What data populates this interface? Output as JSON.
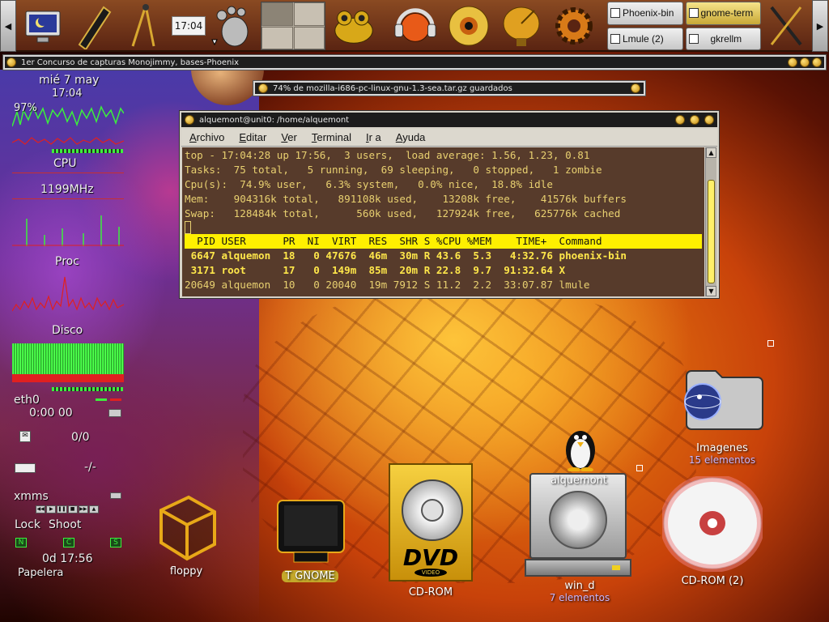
{
  "panel": {
    "clock": "17:04",
    "left_arrow": "◀",
    "right_arrow": "▶",
    "launchers": [
      "display-settings-icon",
      "pen-icon",
      "compass-icon",
      "gnome-foot-icon",
      "frog-icon",
      "headphones-icon",
      "eye-icon",
      "satellite-dish-icon",
      "gear-icon",
      "pen-tool-icon"
    ],
    "tasks": [
      {
        "label": "Phoenix-bin",
        "active": false
      },
      {
        "label": "gnome-term",
        "active": true
      },
      {
        "label": "Lmule (2)",
        "active": false
      },
      {
        "label": "gkrellm",
        "active": false
      }
    ]
  },
  "xmms_bar": {
    "title": "1er Concurso de capturas Monojimmy, bases-Phoenix"
  },
  "download_bar": {
    "title": "74% de mozilla-i686-pc-linux-gnu-1.3-sea.tar.gz guardados"
  },
  "gkrellm": {
    "date": "mié  7 may",
    "time": "17:04",
    "cpu_percent": "97%",
    "cpu_label": "CPU",
    "freq": "1199MHz",
    "proc_label": "Proc",
    "disk_label": "Disco",
    "net_label": "eth0",
    "net_time": "0:00 00",
    "mail_count": "0/0",
    "mail2": "-/-",
    "xmms_label": "xmms",
    "lock_label": "Lock",
    "shoot_label": "Shoot",
    "uptime": "0d 17:56",
    "trash_label": "Papelera",
    "keys": [
      "N",
      "C",
      "S"
    ]
  },
  "terminal": {
    "title": "alquemont@unit0: /home/alquemont",
    "menu": [
      "Archivo",
      "Editar",
      "Ver",
      "Terminal",
      "Ir a",
      "Ayuda"
    ],
    "lines": [
      "top - 17:04:28 up 17:56,  3 users,  load average: 1.56, 1.23, 0.81",
      "Tasks:  75 total,   5 running,  69 sleeping,   0 stopped,   1 zombie",
      "Cpu(s):  74.9% user,   6.3% system,   0.0% nice,  18.8% idle",
      "Mem:    904316k total,   891108k used,    13208k free,    41576k buffers",
      "Swap:   128484k total,      560k used,   127924k free,   625776k cached"
    ],
    "header": "  PID USER      PR  NI  VIRT  RES  SHR S %CPU %MEM    TIME+  Command",
    "procs": [
      " 6647 alquemon  18   0 47676  46m  30m R 43.6  5.3   4:32.76 phoenix-bin",
      " 3171 root      17   0  149m  85m  20m R 22.8  9.7  91:32.64 X",
      "20649 alquemon  10   0 20040  19m 7912 S 11.2  2.2  33:07.87 lmule"
    ]
  },
  "desktop": {
    "icons": [
      {
        "name": "floppy",
        "label": "floppy",
        "sub": ""
      },
      {
        "name": "t-gnome",
        "label": "T GNOME",
        "sub": ""
      },
      {
        "name": "cd-rom",
        "label": "CD-ROM",
        "sub": ""
      },
      {
        "name": "alquemont",
        "label": "alquemont",
        "sub": ""
      },
      {
        "name": "win-d",
        "label": "win_d",
        "sub": "7 elementos"
      },
      {
        "name": "imagenes",
        "label": "Imagenes",
        "sub": "15 elementos"
      },
      {
        "name": "cd-rom-2",
        "label": "CD-ROM (2)",
        "sub": ""
      }
    ],
    "dvd_text": "DVD",
    "dvd_sub": "VIDEO"
  }
}
